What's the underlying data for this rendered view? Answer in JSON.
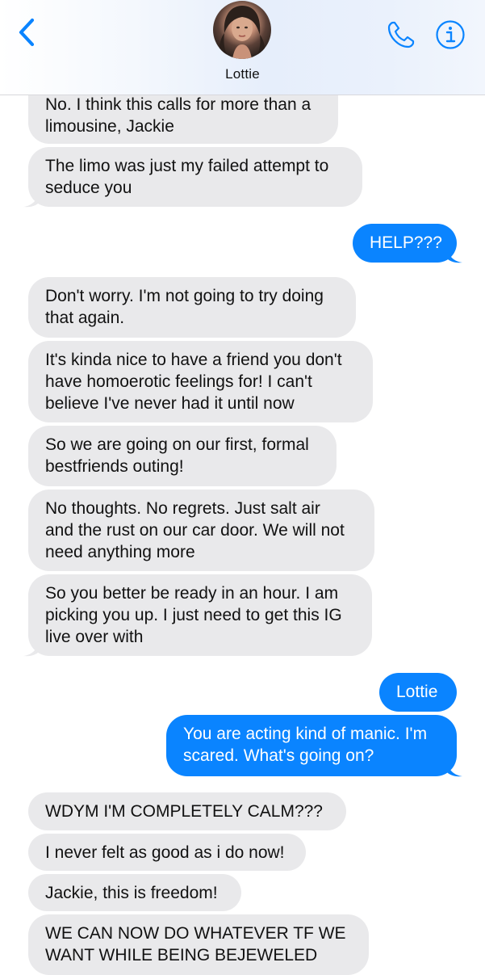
{
  "header": {
    "contact_name": "Lottie",
    "back_icon": "chevron-left-icon",
    "call_icon": "phone-icon",
    "info_icon": "info-icon",
    "accent_color": "#0a84ff"
  },
  "messages": [
    {
      "from": "them",
      "text": "No. I think this calls for more than a\nlimousine, Jackie"
    },
    {
      "from": "them",
      "text": "The limo was just my failed attempt to\nseduce you"
    },
    {
      "from": "me",
      "text": "HELP???"
    },
    {
      "from": "them",
      "text": "Don't worry. I'm not going to try doing\nthat again."
    },
    {
      "from": "them",
      "text": "It's kinda nice to have a friend you don't\nhave homoerotic feelings for! I can't\nbelieve I've never had it until now"
    },
    {
      "from": "them",
      "text": "So we are going on our first, formal\nbestfriends outing!"
    },
    {
      "from": "them",
      "text": "No thoughts. No regrets. Just salt air\nand the rust on our car door. We will not\nneed anything more"
    },
    {
      "from": "them",
      "text": "So you better be ready in an hour. I am\npicking you up. I just need to get this IG\nlive over with"
    },
    {
      "from": "me",
      "text": "Lottie"
    },
    {
      "from": "me",
      "text": "You are acting kind of manic. I'm\nscared. What's going on?"
    },
    {
      "from": "them",
      "text": "WDYM I'M COMPLETELY CALM???"
    },
    {
      "from": "them",
      "text": "I never felt as good as i do now!"
    },
    {
      "from": "them",
      "text": "Jackie, this is freedom!"
    },
    {
      "from": "them",
      "text": "WE CAN NOW DO WHATEVER TF WE\nWANT WHILE  BEING BEJEWELED"
    }
  ],
  "colors": {
    "incoming_bubble": "#e9e9eb",
    "outgoing_bubble": "#0a84ff"
  }
}
